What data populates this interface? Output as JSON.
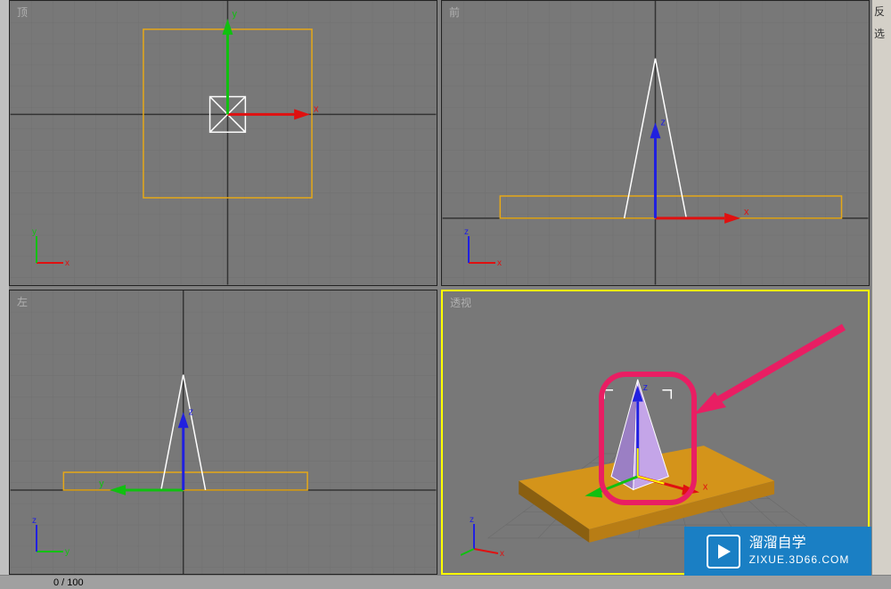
{
  "viewports": {
    "top": {
      "label": "顶",
      "axis1": "y",
      "axis2": "x",
      "gizmo1": "y",
      "gizmo2": "x"
    },
    "front": {
      "label": "前",
      "axis1": "z",
      "axis2": "x",
      "gizmo1": "z",
      "gizmo2": "x"
    },
    "left": {
      "label": "左",
      "axis1": "z",
      "axis2": "y",
      "gizmo1": "z",
      "gizmo2": "y"
    },
    "perspective": {
      "label": "透视",
      "axis1": "z",
      "axis2": "x",
      "axis3": "y"
    }
  },
  "status": {
    "frame": "0 / 100"
  },
  "right_panel": {
    "line1": "反",
    "line2": "选"
  },
  "watermark": {
    "title": "溜溜自学",
    "url": "ZIXUE.3D66.COM"
  },
  "colors": {
    "viewport_bg": "#787878",
    "grid_line": "#6a6a6a",
    "grid_dark": "#333333",
    "selection": "#e6a817",
    "axis_x": "#e01010",
    "axis_y": "#10c010",
    "axis_z": "#1010e0",
    "active_border": "#ffff00",
    "watermark_bg": "#1a7fc4",
    "annotation": "#e91e63"
  }
}
